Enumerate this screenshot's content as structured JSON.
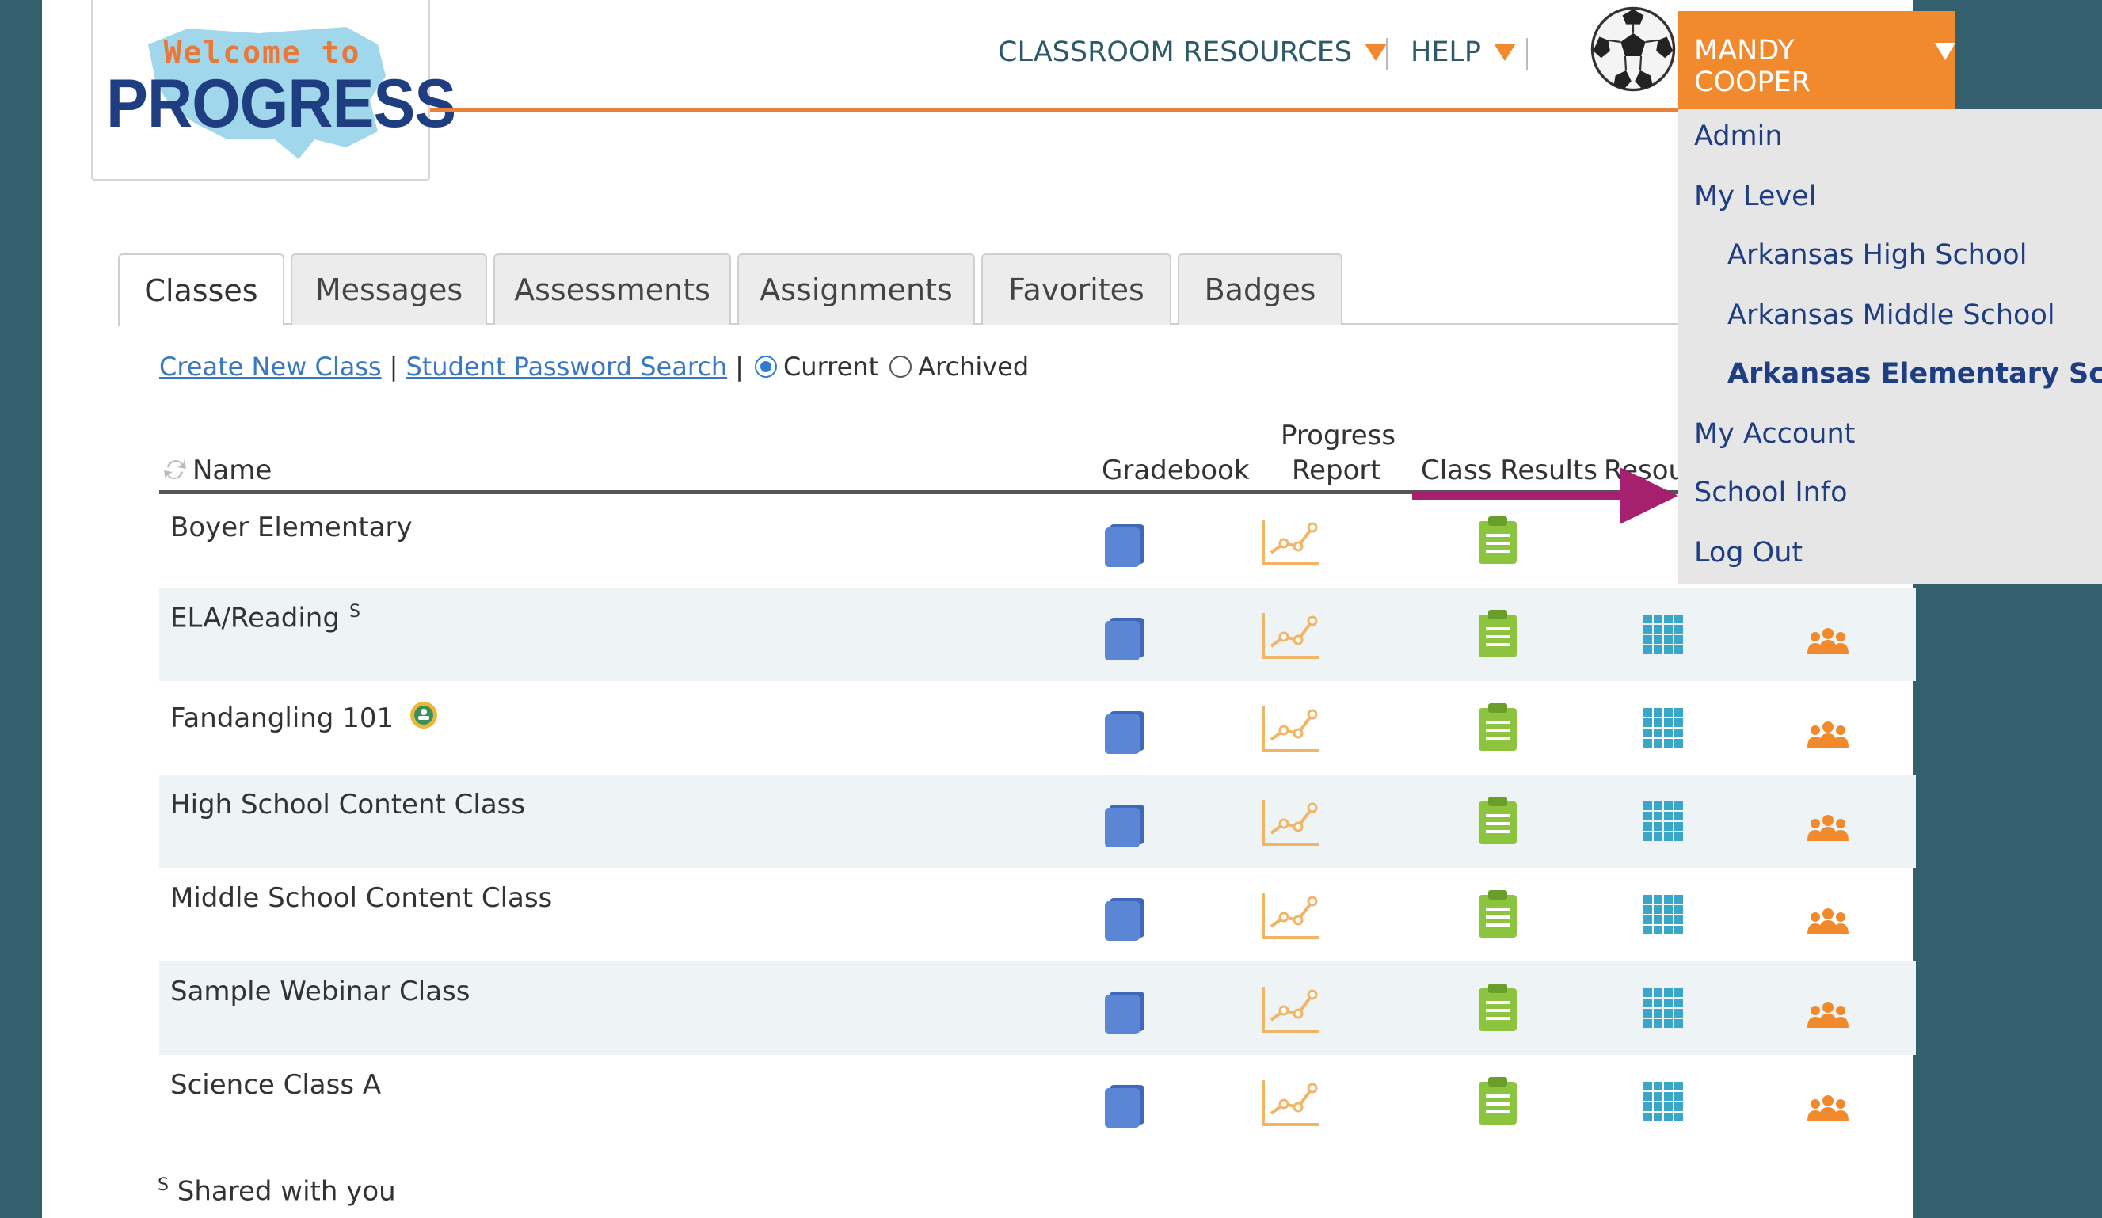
{
  "logo": {
    "welcome": "Welcome to",
    "progress": "PROGRESS"
  },
  "nav": {
    "classroom_resources": "CLASSROOM RESOURCES",
    "help": "HELP",
    "user_name": "MANDY COOPER"
  },
  "dropdown": {
    "items": [
      "Admin",
      "My Level",
      "Arkansas High School",
      "Arkansas Middle School",
      "Arkansas Elementary School",
      "My Account",
      "School Info",
      "Log Out"
    ]
  },
  "tabs": [
    "Classes",
    "Messages",
    "Assessments",
    "Assignments",
    "Favorites",
    "Badges"
  ],
  "links": {
    "create": "Create New Class",
    "search": "Student Password Search",
    "sep": "|",
    "current": "Current",
    "archived": "Archived"
  },
  "table": {
    "headers": {
      "name": "Name",
      "gradebook": "Gradebook",
      "progress_1": "Progress",
      "progress_2": "Report",
      "class_results": "Class Results",
      "resources": "Resou"
    },
    "rows": [
      {
        "name": "Boyer Elementary"
      },
      {
        "name": "ELA/Reading",
        "mark": "S"
      },
      {
        "name": "Fandangling 101"
      },
      {
        "name": "High School Content Class"
      },
      {
        "name": "Middle School Content Class"
      },
      {
        "name": "Sample Webinar Class"
      },
      {
        "name": "Science Class A"
      }
    ]
  },
  "footnote": {
    "mark": "S",
    "text": "Shared with you"
  },
  "colors": {
    "background": "#345f6c",
    "accent": "#f08a2d",
    "link": "#3a78c4",
    "menu_text": "#1f3e82",
    "gradebook_icon": "#5b86d6",
    "report_icon": "#f2b466",
    "results_icon": "#8cc43f",
    "resources_icon": "#3aa6c8",
    "members_icon": "#f08a2d",
    "arrow": "#a5206e"
  },
  "icons": [
    "refresh-icon",
    "gradebook-icon",
    "progress-report-icon",
    "class-results-icon",
    "resources-grid-icon",
    "members-icon",
    "badge-icon",
    "soccer-ball-avatar"
  ]
}
